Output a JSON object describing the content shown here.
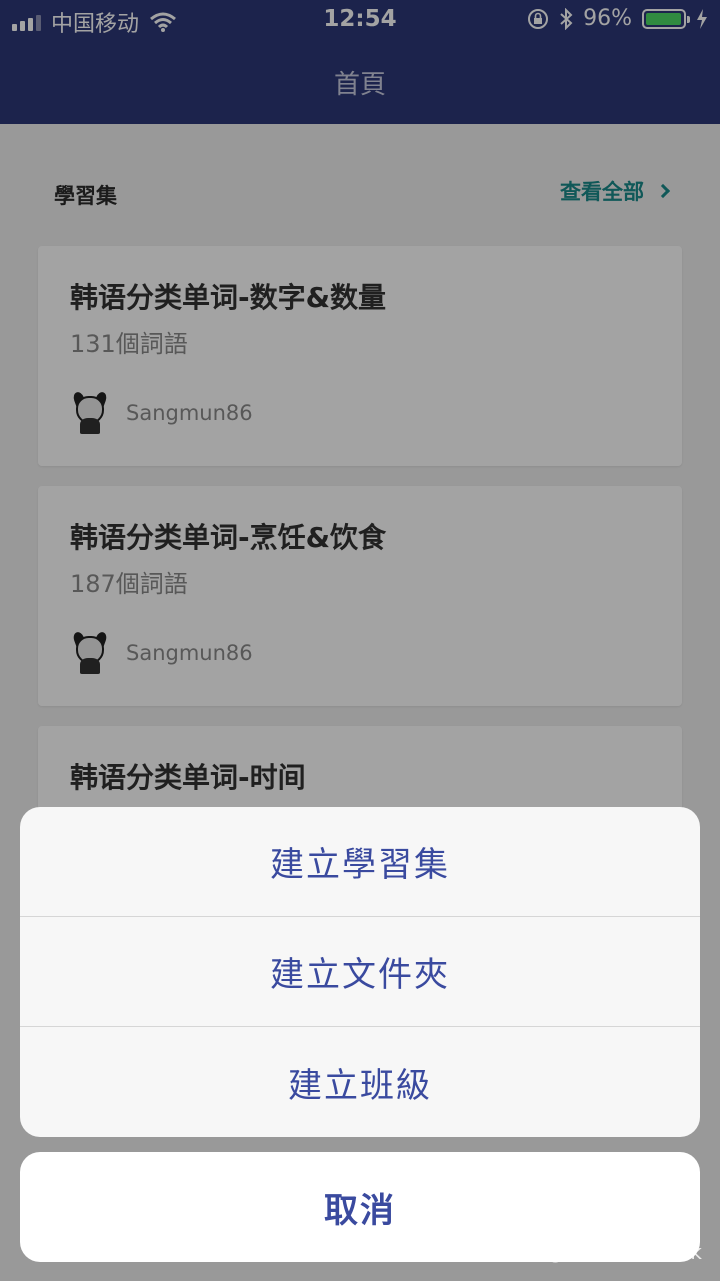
{
  "status_bar": {
    "carrier": "中国移动",
    "time": "12:54",
    "battery_percent": "96%",
    "battery_level": 0.96
  },
  "nav": {
    "title": "首頁"
  },
  "study_sets": {
    "section_title": "學習集",
    "view_all_label": "查看全部",
    "items": [
      {
        "title": "韩语分类单词-数字&数量",
        "count": "131個詞語",
        "author": "Sangmun86"
      },
      {
        "title": "韩语分类单词-烹饪&饮食",
        "count": "187個詞語",
        "author": "Sangmun86"
      },
      {
        "title": "韩语分类单词-时间",
        "count": "",
        "author": ""
      }
    ]
  },
  "action_sheet": {
    "actions": [
      {
        "label": "建立學習集"
      },
      {
        "label": "建立文件夾"
      },
      {
        "label": "建立班級"
      }
    ],
    "cancel_label": "取消"
  },
  "watermark": "知乎 @爱熙说AiXiTalk",
  "colors": {
    "header_bg": "#2c3777",
    "accent_teal": "#1a8a8a",
    "action_blue": "#3a4a9f",
    "battery_green": "#4cd964"
  }
}
